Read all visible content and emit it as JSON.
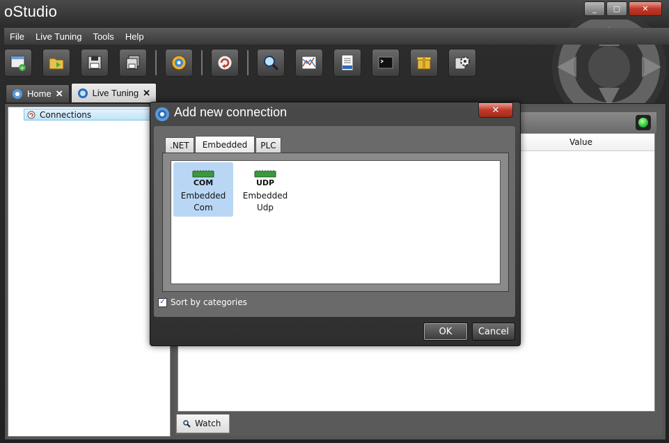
{
  "window": {
    "title": "oStudio",
    "controls": {
      "minimize": "_",
      "maximize": "▢",
      "close": "✕"
    }
  },
  "menu": [
    "File",
    "Live Tuning",
    "Tools",
    "Help"
  ],
  "toolbar": {
    "icons": [
      "new-connection-icon",
      "open-folder-icon",
      "save-icon",
      "save-all-icon",
      "settings-gear-icon",
      "refresh-icon",
      "search-icon",
      "chart-icon",
      "log-icon",
      "terminal-icon",
      "package-icon",
      "plugin-settings-icon"
    ]
  },
  "tabs": [
    {
      "label": "Home",
      "close": "✕"
    },
    {
      "label": "Live Tuning",
      "close": "✕"
    }
  ],
  "left_pane": {
    "items": [
      {
        "label": "Connections"
      }
    ]
  },
  "grid": {
    "columns": [
      "Value"
    ]
  },
  "bottom_tab": {
    "label": "Watch"
  },
  "dialog": {
    "title": "Add new connection",
    "close": "✕",
    "categories": [
      ".NET",
      "Embedded",
      "PLC"
    ],
    "active_category": "Embedded",
    "items": [
      {
        "label_line1": "Embedded",
        "label_line2": "Com",
        "icon_text": "COM",
        "selected": true
      },
      {
        "label_line1": "Embedded",
        "label_line2": "Udp",
        "icon_text": "UDP",
        "selected": false
      }
    ],
    "sort_checkbox": {
      "label": "Sort by categories",
      "checked": true,
      "mark": "✓"
    },
    "ok_label": "OK",
    "cancel_label": "Cancel"
  },
  "colors": {
    "accent_selection": "#b9d7f5",
    "close_red": "#c0392b",
    "status_green": "#2ecc40"
  }
}
